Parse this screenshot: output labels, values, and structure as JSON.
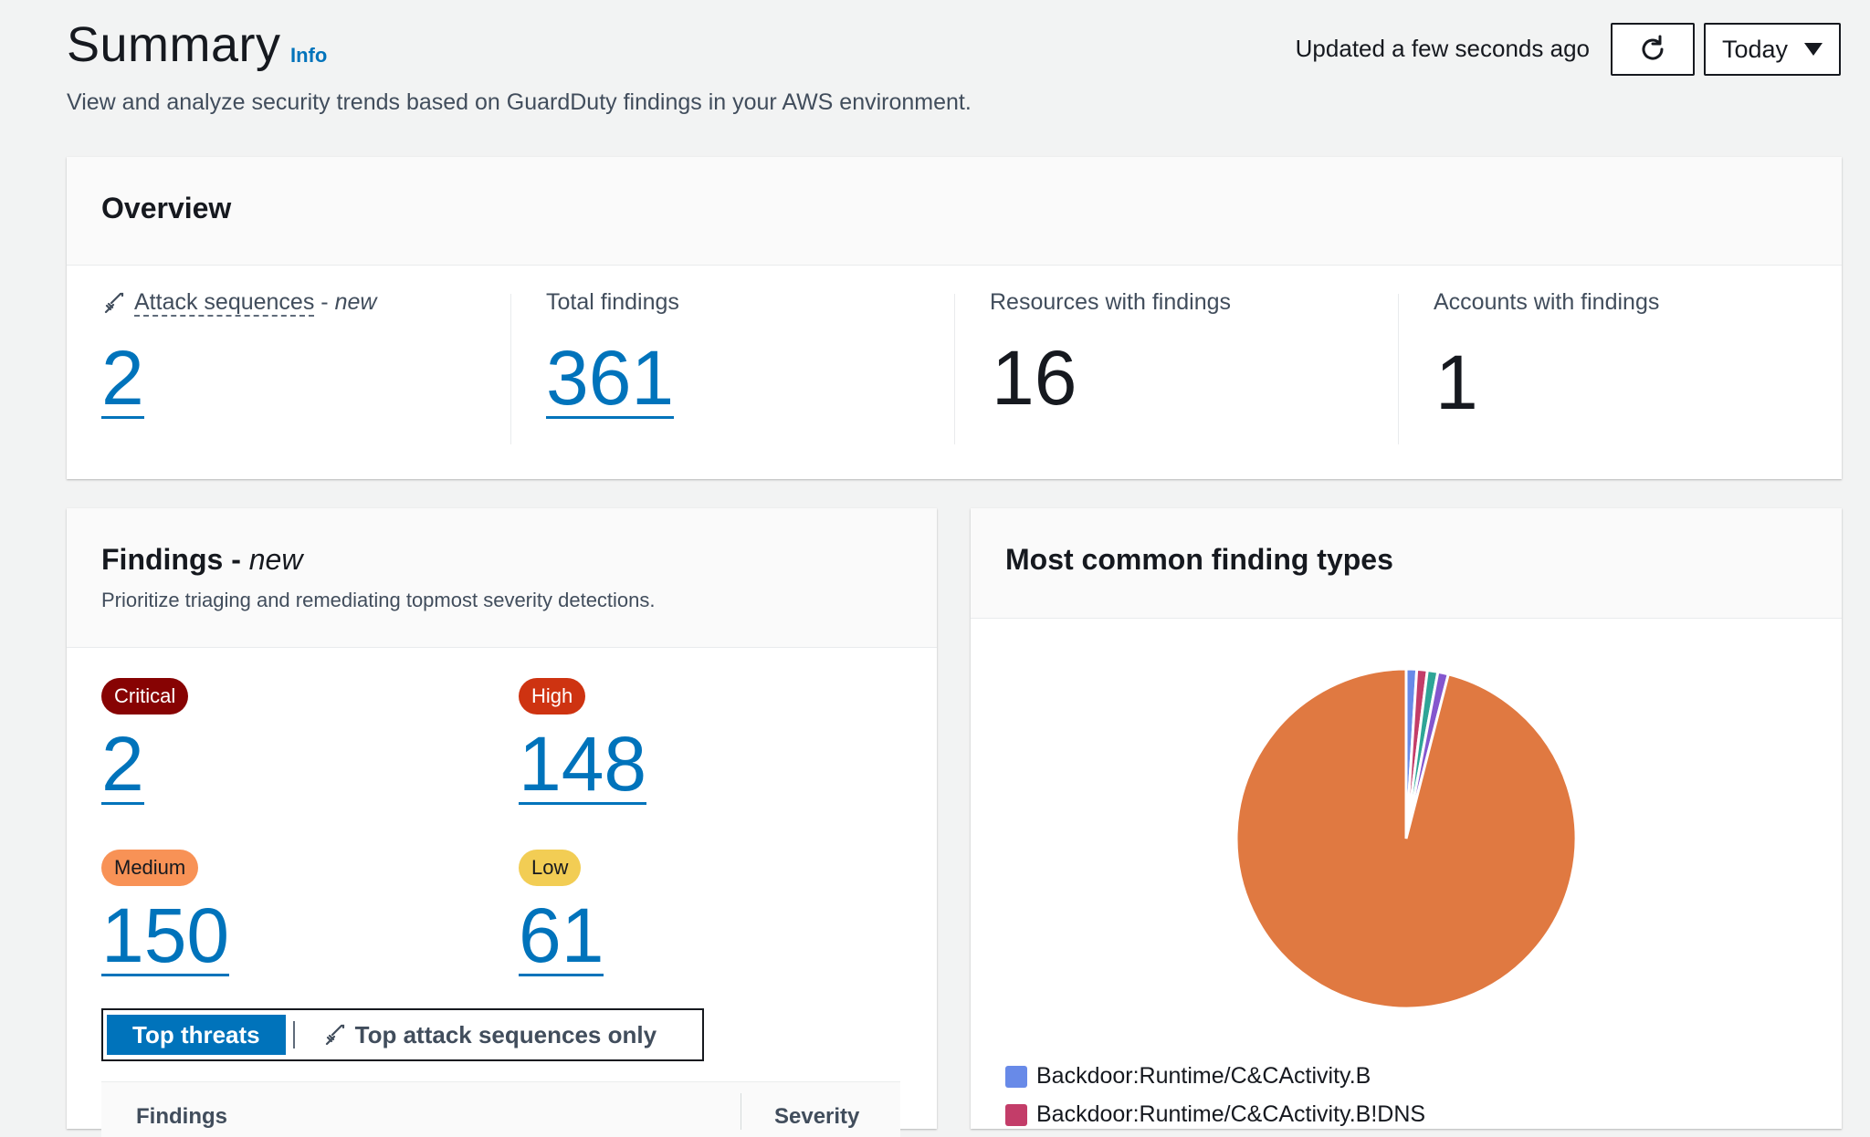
{
  "header": {
    "title": "Summary",
    "info": "Info",
    "subtitle": "View and analyze security trends based on GuardDuty findings in your AWS environment.",
    "updated": "Updated a few seconds ago",
    "range": "Today",
    "refresh_icon": "refresh-icon"
  },
  "overview": {
    "title": "Overview",
    "attack": {
      "label": "Attack sequences",
      "dash": " - ",
      "new": "new",
      "value": "2",
      "icon": "sword-icon"
    },
    "total": {
      "label": "Total findings",
      "value": "361"
    },
    "resources": {
      "label": "Resources with findings",
      "value": "16"
    },
    "accounts": {
      "label": "Accounts with findings",
      "value": "1"
    }
  },
  "findings": {
    "title": "Findings - ",
    "new": "new",
    "description": "Prioritize triaging and remediating topmost severity detections.",
    "severities": [
      {
        "label": "Critical",
        "value": "2"
      },
      {
        "label": "High",
        "value": "148"
      },
      {
        "label": "Medium",
        "value": "150"
      },
      {
        "label": "Low",
        "value": "61"
      }
    ],
    "tabs": {
      "active": "Top threats",
      "other": "Top attack sequences only"
    },
    "table": {
      "col1": "Findings",
      "col2": "Severity"
    }
  },
  "types": {
    "title": "Most common finding types",
    "legend": [
      {
        "label": "Backdoor:Runtime/C&CActivity.B",
        "color": "#688ae8"
      },
      {
        "label": "Backdoor:Runtime/C&CActivity.B!DNS",
        "color": "#c33d69"
      }
    ]
  },
  "chart_data": {
    "type": "pie",
    "slices": [
      {
        "label": "Backdoor:Runtime/C&CActivity.B",
        "value": 1,
        "color": "#688ae8"
      },
      {
        "label": "Backdoor:Runtime/C&CActivity.B!DNS",
        "value": 1,
        "color": "#c33d69"
      },
      {
        "label": "",
        "value": 1,
        "color": "#2ea597"
      },
      {
        "label": "",
        "value": 1,
        "color": "#8456ce"
      },
      {
        "label": "",
        "value": 96,
        "color": "#e07941"
      }
    ]
  }
}
